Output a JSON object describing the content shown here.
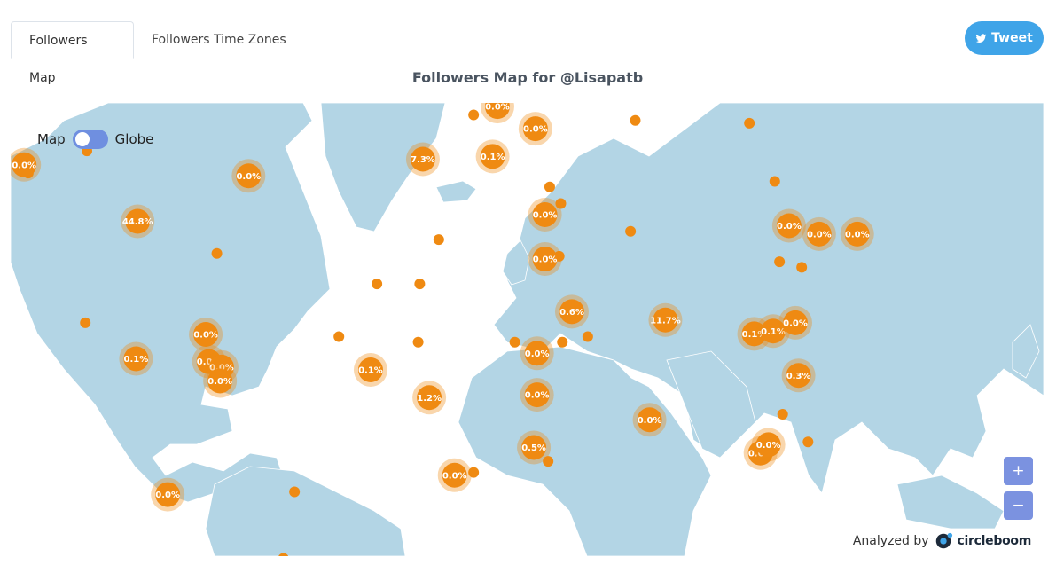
{
  "tabs": {
    "map": "Followers Map",
    "timezones": "Followers Time Zones"
  },
  "tweet_label": "Tweet",
  "title": "Followers Map for @Lisapatb",
  "toggle": {
    "left": "Map",
    "right": "Globe"
  },
  "zoom": {
    "in": "+",
    "out": "−"
  },
  "attribution": {
    "prefix": "Analyzed by",
    "brand": "circleboom"
  },
  "colors": {
    "land": "#b3d5e5",
    "marker": "#ef8a12",
    "accent": "#3fa4e8",
    "zoom": "#7b92e0"
  },
  "clusters": [
    {
      "lat": 49.0,
      "lon": -123.8,
      "label": "0.0%"
    },
    {
      "lat": 47.0,
      "lon": -53.0,
      "label": "0.0%"
    },
    {
      "lat": 38.8,
      "lon": -88.0,
      "label": "44.8%"
    },
    {
      "lat": 18.4,
      "lon": -66.5,
      "label": "0.0%"
    },
    {
      "lat": 14.0,
      "lon": -88.5,
      "label": "0.1%"
    },
    {
      "lat": 13.5,
      "lon": -65.5,
      "label": "0.0%"
    },
    {
      "lat": 12.5,
      "lon": -61.5,
      "label": "0.0%"
    },
    {
      "lat": 10.0,
      "lon": -62.0,
      "label": "0.0%"
    },
    {
      "lat": -10.5,
      "lon": -78.5,
      "label": "0.0%"
    },
    {
      "lat": 50.0,
      "lon": 2.0,
      "label": "7.3%"
    },
    {
      "lat": 59.5,
      "lon": 25.5,
      "label": "0.0%"
    },
    {
      "lat": 55.5,
      "lon": 37.5,
      "label": "0.0%"
    },
    {
      "lat": 50.5,
      "lon": 24.0,
      "label": "0.1%"
    },
    {
      "lat": 40.0,
      "lon": 40.5,
      "label": "0.0%"
    },
    {
      "lat": 32.0,
      "lon": 40.5,
      "label": "0.0%"
    },
    {
      "lat": 22.5,
      "lon": 49.0,
      "label": "0.6%"
    },
    {
      "lat": 15.0,
      "lon": 38.0,
      "label": "0.0%"
    },
    {
      "lat": 21.0,
      "lon": 78.5,
      "label": "11.7%"
    },
    {
      "lat": 12.0,
      "lon": -14.5,
      "label": "0.1%"
    },
    {
      "lat": 7.0,
      "lon": 4.0,
      "label": "1.2%"
    },
    {
      "lat": 7.5,
      "lon": 38.0,
      "label": "0.0%"
    },
    {
      "lat": -2.0,
      "lon": 37.0,
      "label": "0.5%"
    },
    {
      "lat": -7.0,
      "lon": 12.0,
      "label": "0.0%"
    },
    {
      "lat": 3.0,
      "lon": 73.5,
      "label": "0.0%"
    },
    {
      "lat": 38.0,
      "lon": 117.5,
      "label": "0.0%"
    },
    {
      "lat": 36.5,
      "lon": 127.0,
      "label": "0.0%"
    },
    {
      "lat": 36.5,
      "lon": 139.0,
      "label": "0.0%"
    },
    {
      "lat": 18.5,
      "lon": 106.5,
      "label": "0.1%"
    },
    {
      "lat": 19.0,
      "lon": 112.5,
      "label": "0.1%"
    },
    {
      "lat": 20.5,
      "lon": 119.5,
      "label": "0.0%"
    },
    {
      "lat": 11.0,
      "lon": 120.5,
      "label": "0.3%"
    },
    {
      "lat": -3.0,
      "lon": 108.5,
      "label": "0.6%"
    },
    {
      "lat": -1.5,
      "lon": 111.0,
      "label": "0.0%"
    }
  ],
  "points": [
    {
      "lat": 47.5,
      "lon": -122.5
    },
    {
      "lat": 51.5,
      "lon": -104.0
    },
    {
      "lat": 65.0,
      "lon": -19.0
    },
    {
      "lat": 33.0,
      "lon": -63.0
    },
    {
      "lat": 20.5,
      "lon": -104.5
    },
    {
      "lat": 58.0,
      "lon": 18.0
    },
    {
      "lat": 57.0,
      "lon": 69.0
    },
    {
      "lat": 56.5,
      "lon": 105.0
    },
    {
      "lat": 46.0,
      "lon": 113.0
    },
    {
      "lat": 45.0,
      "lon": 42.0
    },
    {
      "lat": 42.0,
      "lon": 45.5
    },
    {
      "lat": 37.0,
      "lon": 67.5
    },
    {
      "lat": 32.5,
      "lon": 45.0
    },
    {
      "lat": 31.5,
      "lon": 114.5
    },
    {
      "lat": 30.5,
      "lon": 121.5
    },
    {
      "lat": 35.5,
      "lon": 7.0
    },
    {
      "lat": 27.5,
      "lon": -12.5
    },
    {
      "lat": 27.5,
      "lon": 1.0
    },
    {
      "lat": 18.0,
      "lon": -24.5
    },
    {
      "lat": 17.0,
      "lon": 0.5
    },
    {
      "lat": 17.0,
      "lon": 31.0
    },
    {
      "lat": 17.0,
      "lon": 46.0
    },
    {
      "lat": 18.0,
      "lon": 54.0
    },
    {
      "lat": -10.0,
      "lon": -38.5
    },
    {
      "lat": -22.0,
      "lon": -42.0
    },
    {
      "lat": -6.5,
      "lon": 18.0
    },
    {
      "lat": -4.5,
      "lon": 41.5
    },
    {
      "lat": 4.0,
      "lon": 115.5
    },
    {
      "lat": -1.0,
      "lon": 123.5
    }
  ]
}
